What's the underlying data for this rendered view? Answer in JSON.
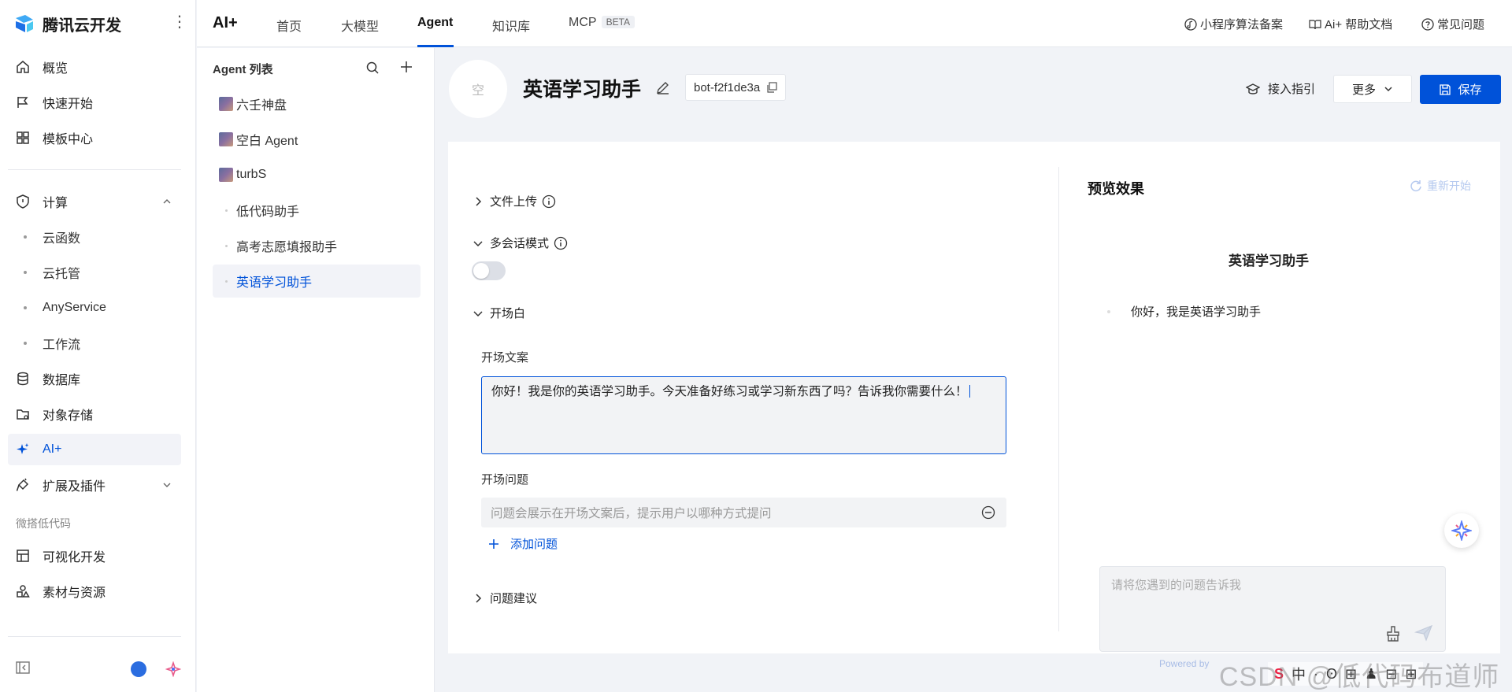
{
  "brand": {
    "name": "腾讯云开发",
    "more": "⋮"
  },
  "sidebar": {
    "items": [
      {
        "label": "概览",
        "icon": "home-icon"
      },
      {
        "label": "快速开始",
        "icon": "flag-icon"
      },
      {
        "label": "模板中心",
        "icon": "grid-icon"
      }
    ],
    "compute": {
      "label": "计算",
      "icon": "shield-icon"
    },
    "compute_subitems": [
      "云函数",
      "云托管",
      "AnyService",
      "工作流"
    ],
    "items2": [
      {
        "label": "数据库",
        "icon": "database-icon"
      },
      {
        "label": "对象存储",
        "icon": "folder-icon"
      },
      {
        "label": "AI+",
        "icon": "sparkle-icon"
      },
      {
        "label": "扩展及插件",
        "icon": "plugin-icon"
      }
    ],
    "group_label": "微搭低代码",
    "items3": [
      {
        "label": "可视化开发",
        "icon": "visual-icon"
      },
      {
        "label": "素材与资源",
        "icon": "shapes-icon"
      }
    ],
    "active_color": "#0052d9"
  },
  "topbar": {
    "product": "AI+",
    "tabs": [
      "首页",
      "大模型",
      "Agent",
      "知识库",
      "MCP"
    ],
    "beta": "BETA",
    "active_tab": "Agent",
    "links": [
      "小程序算法备案",
      "Ai+ 帮助文档",
      "常见问题"
    ]
  },
  "agent_list": {
    "title": "Agent 列表",
    "items": [
      "六壬神盘",
      "空白 Agent",
      "turbS",
      "低代码助手",
      "高考志愿填报助手",
      "英语学习助手"
    ],
    "active": "英语学习助手"
  },
  "bot": {
    "avatar_text": "空",
    "title": "英语学习助手",
    "id": "bot-f2f1de3a",
    "guide": "接入指引",
    "more": "更多",
    "save": "保存"
  },
  "config": {
    "file_upload": "文件上传",
    "multi_session": "多会话模式",
    "multi_session_enabled": false,
    "opening": "开场白",
    "opening_text_label": "开场文案",
    "opening_text": "你好！我是你的英语学习助手。今天准备好练习或学习新东西了吗？告诉我你需要什么！",
    "opening_question_label": "开场问题",
    "question_placeholder": "问题会展示在开场文案后，提示用户以哪种方式提问",
    "add_question": "添加问题",
    "suggestions": "问题建议"
  },
  "preview": {
    "title": "预览效果",
    "restart": "重新开始",
    "bot_name": "英语学习助手",
    "greeting": "你好，我是英语学习助手",
    "input_placeholder": "请将您遇到的问题告诉我",
    "powered": "Powered by"
  },
  "overlay": {
    "watermark": "CSDN @低代码布道师",
    "ime": [
      "S",
      "中",
      "·",
      "ʘ",
      "⊞",
      "♟",
      "⊟",
      "⊞"
    ]
  }
}
